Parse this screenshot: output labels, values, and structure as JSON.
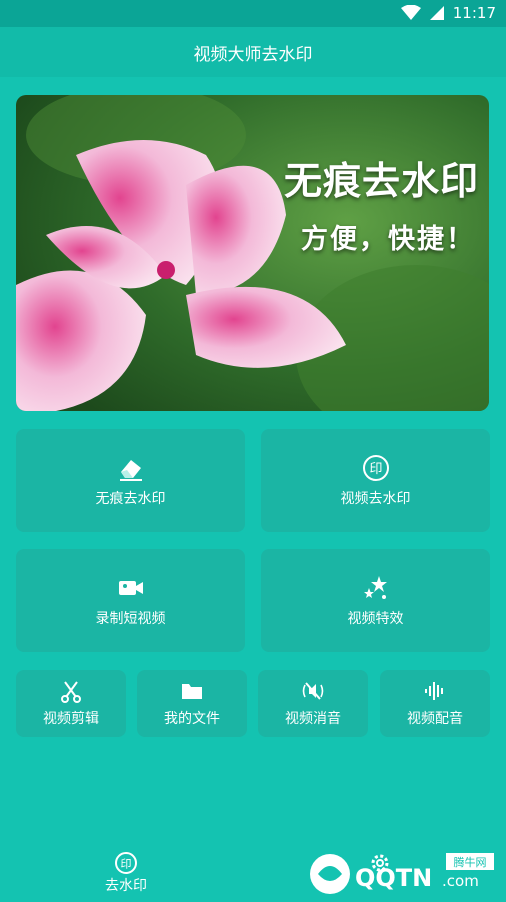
{
  "status": {
    "time": "11:17"
  },
  "app": {
    "title": "视频大师去水印"
  },
  "banner": {
    "title": "无痕去水印",
    "subtitle": "方便，快捷！"
  },
  "cards_large": [
    {
      "label": "无痕去水印",
      "icon": "eraser-icon"
    },
    {
      "label": "视频去水印",
      "icon": "stamp-icon"
    },
    {
      "label": "录制短视频",
      "icon": "video-camera-icon"
    },
    {
      "label": "视频特效",
      "icon": "sparkle-stars-icon"
    }
  ],
  "cards_small": [
    {
      "label": "视频剪辑",
      "icon": "scissors-icon"
    },
    {
      "label": "我的文件",
      "icon": "folder-icon"
    },
    {
      "label": "视频消音",
      "icon": "mute-icon"
    },
    {
      "label": "视频配音",
      "icon": "soundwave-icon"
    }
  ],
  "nav": {
    "home_label": "去水印"
  },
  "watermark": {
    "brand": "QQTN.com",
    "tag": "腾牛网"
  },
  "colors": {
    "background": "#14c3b1",
    "card": "#1bb5a4",
    "statusbar": "#0ba596"
  }
}
